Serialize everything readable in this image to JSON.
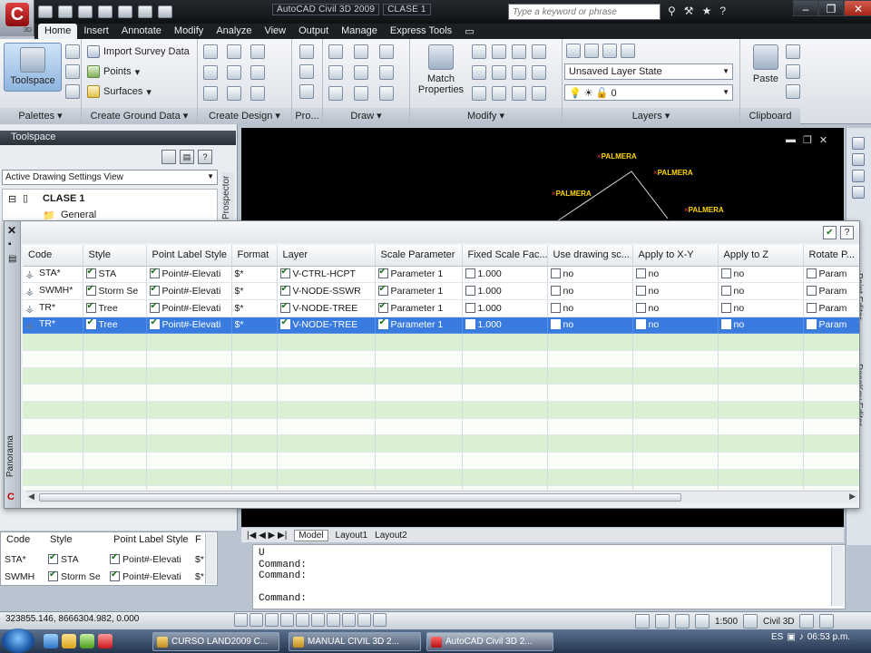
{
  "app": {
    "logo_letter": "C",
    "logo_version": "3D",
    "title": "AutoCAD Civil 3D 2009",
    "drawing_name": "CLASE 1"
  },
  "search": {
    "placeholder": "Type a keyword or phrase"
  },
  "ribbon": {
    "tabs": [
      "Home",
      "Insert",
      "Annotate",
      "Modify",
      "Analyze",
      "View",
      "Output",
      "Manage",
      "Express Tools"
    ],
    "active_tab": "Home",
    "panels": {
      "palettes": {
        "label": "Palettes",
        "toolspace": "Toolspace"
      },
      "ground": {
        "label": "Create Ground Data",
        "items": [
          "Import Survey Data",
          "Points",
          "Surfaces"
        ]
      },
      "design": {
        "label": "Create Design"
      },
      "profile": {
        "label": "Pro..."
      },
      "draw": {
        "label": "Draw"
      },
      "modify": {
        "label": "Modify",
        "match": "Match Properties"
      },
      "layers": {
        "label": "Layers",
        "layer_state": "Unsaved Layer State",
        "current_layer": "0"
      },
      "clipboard": {
        "label": "Clipboard",
        "paste": "Paste"
      }
    }
  },
  "toolspace": {
    "title": "Toolspace",
    "view": "Active Drawing Settings View",
    "tree": [
      "CLASE 1",
      "General"
    ],
    "prospector_tab": "Prospector"
  },
  "drawing": {
    "labels": [
      "PALMERA",
      "PALMERA",
      "PALMERA",
      "PALMERA"
    ]
  },
  "point_editor": {
    "side_tab": "Panorama",
    "right_tabs": [
      "Point Editor",
      "DescKey Editor"
    ],
    "columns": [
      "Code",
      "Style",
      "Point Label Style",
      "Format",
      "Layer",
      "Scale Parameter",
      "Fixed Scale Fac...",
      "Use drawing sc...",
      "Apply to X-Y",
      "Apply to Z",
      "Rotate P..."
    ],
    "rows": [
      {
        "code": "STA*",
        "style": "STA",
        "label_style": "Point#-Elevati",
        "format": "$*",
        "layer": "V-CTRL-HCPT",
        "scale": "Parameter 1",
        "fixed": "1.000",
        "use": "no",
        "xy": "no",
        "z": "no",
        "rot": "Param"
      },
      {
        "code": "SWMH*",
        "style": "Storm Se",
        "label_style": "Point#-Elevati",
        "format": "$*",
        "layer": "V-NODE-SSWR",
        "scale": "Parameter 1",
        "fixed": "1.000",
        "use": "no",
        "xy": "no",
        "z": "no",
        "rot": "Param"
      },
      {
        "code": "TR*",
        "style": "Tree",
        "label_style": "Point#-Elevati",
        "format": "$*",
        "layer": "V-NODE-TREE",
        "scale": "Parameter 1",
        "fixed": "1.000",
        "use": "no",
        "xy": "no",
        "z": "no",
        "rot": "Param"
      },
      {
        "code": "TR*",
        "style": "Tree",
        "label_style": "Point#-Elevati",
        "format": "$*",
        "layer": "V-NODE-TREE",
        "scale": "Parameter 1",
        "fixed": "1.000",
        "use": "no",
        "xy": "no",
        "z": "no",
        "rot": "Param"
      }
    ],
    "selected_row": 3
  },
  "mini_grid": {
    "columns": [
      "Code",
      "Style",
      "Point Label Style",
      "F"
    ],
    "rows": [
      {
        "code": "STA*",
        "style": "STA",
        "label_style": "Point#-Elevati",
        "format": "$*"
      },
      {
        "code": "SWMH",
        "style": "Storm Se",
        "label_style": "Point#-Elevati",
        "format": "$*"
      }
    ]
  },
  "layout_tabs": [
    "Model",
    "Layout1",
    "Layout2"
  ],
  "command_line": [
    "U",
    "Command:",
    "Command:",
    "",
    "Command:"
  ],
  "status": {
    "coords": "323855.146, 8666304.982, 0.000",
    "scale": "1:500",
    "workspace": "Civil 3D"
  },
  "taskbar": {
    "tasks": [
      "CURSO LAND2009 C...",
      "MANUAL CIVIL 3D 2...",
      "AutoCAD Civil 3D 2..."
    ],
    "lang": "ES",
    "time": "06:53 p.m."
  }
}
